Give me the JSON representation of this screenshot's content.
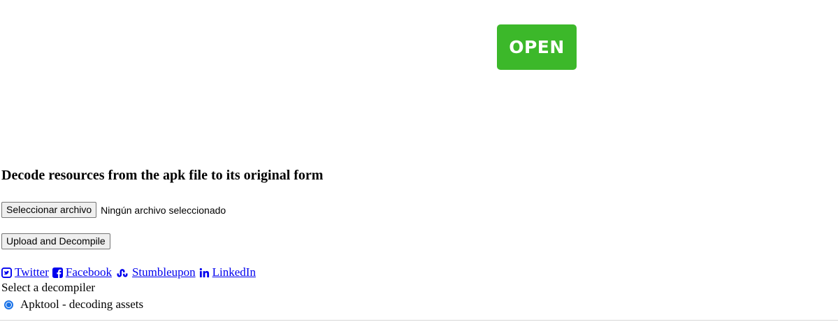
{
  "ad": {
    "open_label": "OPEN",
    "color": "#3cb82a"
  },
  "heading": "Decode resources from the apk file to its original form",
  "file_input": {
    "button_label": "Seleccionar archivo",
    "status": "Ningún archivo seleccionado"
  },
  "upload": {
    "button_label": "Upload and Decompile"
  },
  "social": {
    "links": [
      {
        "label": "Twitter",
        "icon": "twitter-icon"
      },
      {
        "label": "Facebook",
        "icon": "facebook-icon"
      },
      {
        "label": "Stumbleupon",
        "icon": "stumbleupon-icon"
      },
      {
        "label": "LinkedIn",
        "icon": "linkedin-icon"
      }
    ],
    "link_color": "#0000ee"
  },
  "decompiler": {
    "label": "Select a decompiler",
    "options": [
      {
        "label": "Apktool - decoding assets",
        "selected": true
      }
    ]
  }
}
